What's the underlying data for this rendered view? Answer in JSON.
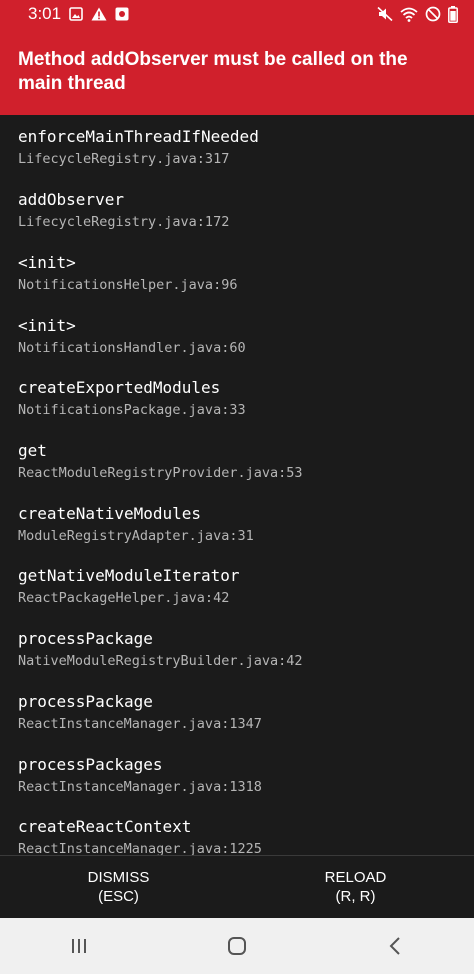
{
  "status_bar": {
    "time": "3:01",
    "left_icons": [
      "image-notification-icon",
      "warning-icon",
      "app-notification-icon"
    ],
    "right_icons": [
      "mute-icon",
      "wifi-icon",
      "do-not-disturb-icon",
      "battery-icon"
    ]
  },
  "error": {
    "title": "Method addObserver must be called on the main thread"
  },
  "stack_trace": [
    {
      "method": "enforceMainThreadIfNeeded",
      "location": "LifecycleRegistry.java:317"
    },
    {
      "method": "addObserver",
      "location": "LifecycleRegistry.java:172"
    },
    {
      "method": "<init>",
      "location": "NotificationsHelper.java:96"
    },
    {
      "method": "<init>",
      "location": "NotificationsHandler.java:60"
    },
    {
      "method": "createExportedModules",
      "location": "NotificationsPackage.java:33"
    },
    {
      "method": "get",
      "location": "ReactModuleRegistryProvider.java:53"
    },
    {
      "method": "createNativeModules",
      "location": "ModuleRegistryAdapter.java:31"
    },
    {
      "method": "getNativeModuleIterator",
      "location": "ReactPackageHelper.java:42"
    },
    {
      "method": "processPackage",
      "location": "NativeModuleRegistryBuilder.java:42"
    },
    {
      "method": "processPackage",
      "location": "ReactInstanceManager.java:1347"
    },
    {
      "method": "processPackages",
      "location": "ReactInstanceManager.java:1318"
    },
    {
      "method": "createReactContext",
      "location": "ReactInstanceManager.java:1225"
    }
  ],
  "buttons": {
    "dismiss": {
      "label": "DISMISS",
      "shortcut": "(ESC)"
    },
    "reload": {
      "label": "RELOAD",
      "shortcut": "(R, R)"
    }
  },
  "nav_bar": [
    "recent-apps-icon",
    "home-icon",
    "back-icon"
  ],
  "colors": {
    "error_red": "#d0202c",
    "background": "#1b1b1b",
    "location_text": "#b5b5b5"
  }
}
